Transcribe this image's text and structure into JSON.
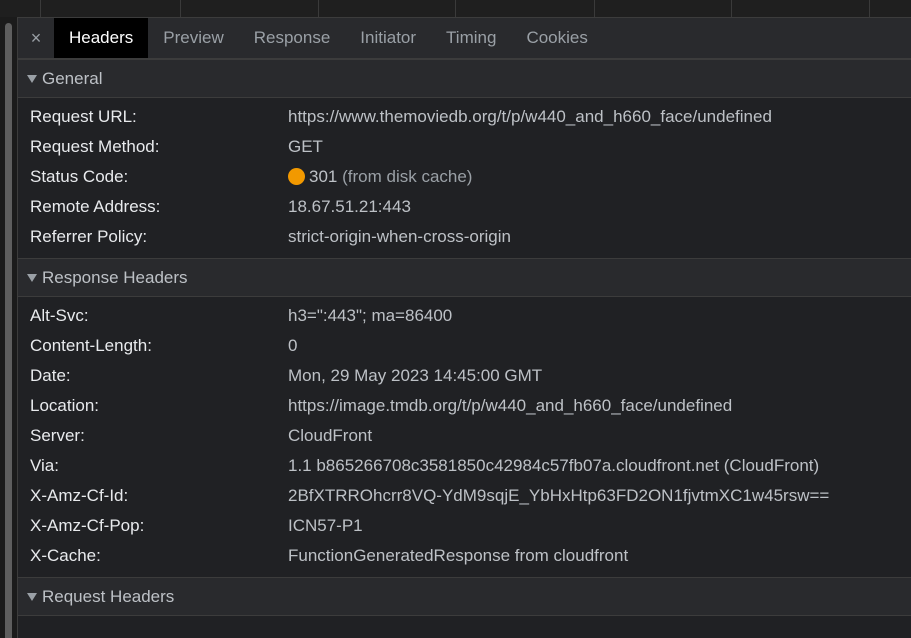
{
  "tabs": {
    "close_glyph": "×",
    "items": [
      "Headers",
      "Preview",
      "Response",
      "Initiator",
      "Timing",
      "Cookies"
    ],
    "active": "Headers"
  },
  "sections": {
    "general": {
      "title": "General",
      "rows": [
        {
          "key": "Request URL:",
          "value": "https://www.themoviedb.org/t/p/w440_and_h660_face/undefined"
        },
        {
          "key": "Request Method:",
          "value": "GET"
        },
        {
          "key": "Status Code:",
          "value": "301",
          "note": "(from disk cache)"
        },
        {
          "key": "Remote Address:",
          "value": "18.67.51.21:443"
        },
        {
          "key": "Referrer Policy:",
          "value": "strict-origin-when-cross-origin"
        }
      ]
    },
    "response": {
      "title": "Response Headers",
      "rows": [
        {
          "key": "Alt-Svc:",
          "value": "h3=\":443\"; ma=86400"
        },
        {
          "key": "Content-Length:",
          "value": "0"
        },
        {
          "key": "Date:",
          "value": "Mon, 29 May 2023 14:45:00 GMT"
        },
        {
          "key": "Location:",
          "value": "https://image.tmdb.org/t/p/w440_and_h660_face/undefined"
        },
        {
          "key": "Server:",
          "value": "CloudFront"
        },
        {
          "key": "Via:",
          "value": "1.1 b865266708c3581850c42984c57fb07a.cloudfront.net (CloudFront)"
        },
        {
          "key": "X-Amz-Cf-Id:",
          "value": "2BfXTRROhcrr8VQ-YdM9sqjE_YbHxHtp63FD2ON1fjvtmXC1w45rsw=="
        },
        {
          "key": "X-Amz-Cf-Pop:",
          "value": "ICN57-P1"
        },
        {
          "key": "X-Cache:",
          "value": "FunctionGeneratedResponse from cloudfront"
        }
      ]
    },
    "request": {
      "title": "Request Headers"
    }
  },
  "colors": {
    "status_dot": "#f29900",
    "active_tab_bg": "#000000",
    "panel_bg": "#202124"
  }
}
